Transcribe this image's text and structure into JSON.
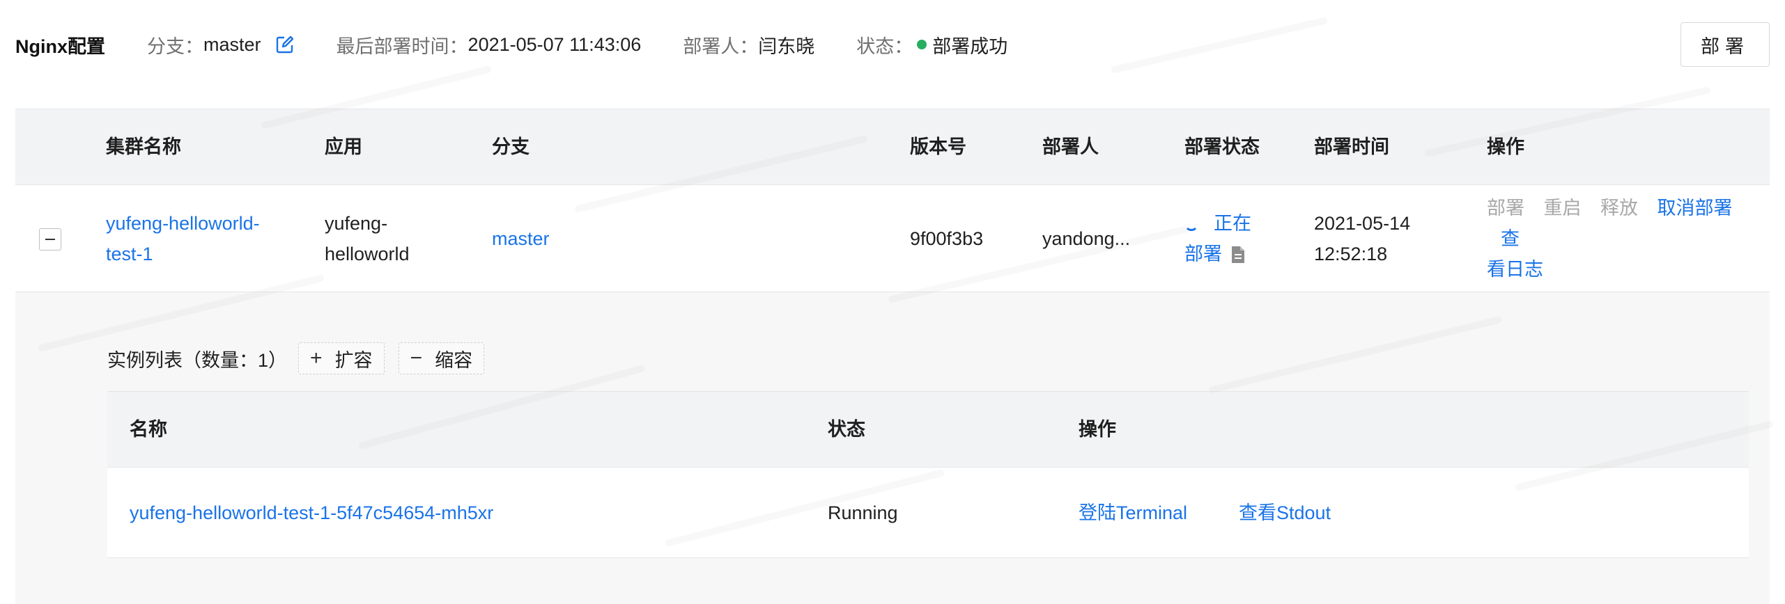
{
  "info": {
    "title": "Nginx配置",
    "branch_label": "分支：",
    "branch_value": "master",
    "last_deploy_label": "最后部署时间：",
    "last_deploy_value": "2021-05-07 11:43:06",
    "deployer_label": "部署人：",
    "deployer_value": "闫东晓",
    "status_label": "状态：",
    "status_value": "部署成功",
    "status_color": "#27ae60",
    "deploy_button": "部署"
  },
  "main_table": {
    "headers": [
      "集群名称",
      "应用",
      "分支",
      "版本号",
      "部署人",
      "部署状态",
      "部署时间",
      "操作"
    ],
    "row": {
      "cluster_line1": "yufeng-helloworld-",
      "cluster_line2": "test-1",
      "app_line1": "yufeng-",
      "app_line2": "helloworld",
      "branch": "master",
      "version": "9f00f3b3",
      "deployer": "yandong...",
      "status_line1": "正在",
      "status_line2": "部署",
      "time_line1": "2021-05-14",
      "time_line2": "12:52:18",
      "actions": {
        "deploy": "部署",
        "restart": "重启",
        "release": "释放",
        "cancel_deploy": "取消部署",
        "view_log_part1": "查",
        "view_log_part2": "看日志"
      }
    }
  },
  "instances": {
    "title": "实例列表（数量：1）",
    "scale_up": "扩容",
    "scale_down": "缩容",
    "headers": [
      "名称",
      "状态",
      "操作"
    ],
    "row": {
      "name": "yufeng-helloworld-test-1-5f47c54654-mh5xr",
      "status": "Running",
      "login_terminal": "登陆Terminal",
      "view_stdout": "查看Stdout"
    }
  },
  "colors": {
    "link": "#1a73e8",
    "header_bg": "#f2f3f5",
    "expand_bg": "#f7f7f7"
  }
}
